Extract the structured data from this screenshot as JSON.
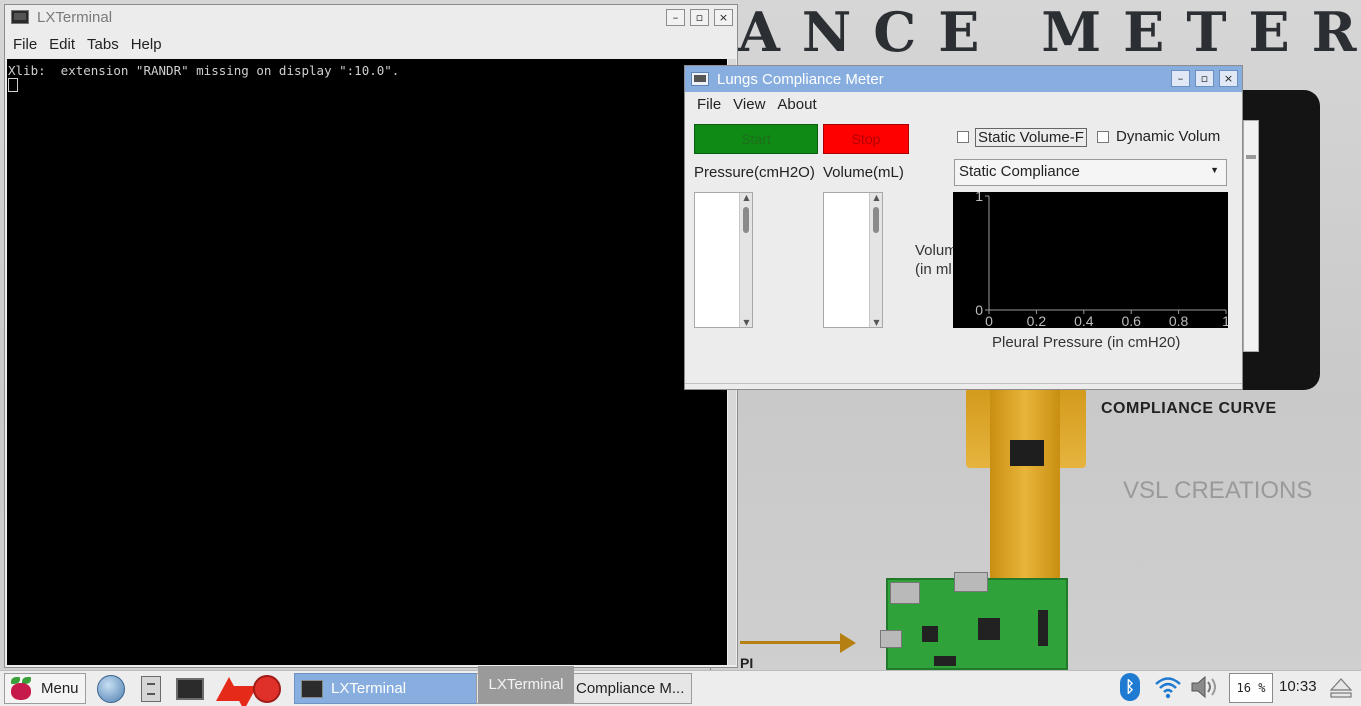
{
  "wallpaper": {
    "title_part1": "ANCE",
    "title_part2": "METER",
    "compliance_curve": "COMPLIANCE CURVE",
    "credit": "VSL CREATIONS",
    "pi_label": "PI"
  },
  "terminal": {
    "title": "LXTerminal",
    "menu": [
      "File",
      "Edit",
      "Tabs",
      "Help"
    ],
    "output": "Xlib:  extension \"RANDR\" missing on display \":10.0\".",
    "controls": {
      "minimize": "–",
      "maximize": "▫",
      "close": "×"
    }
  },
  "lungs_window": {
    "title": "Lungs Compliance Meter",
    "menu": [
      "File",
      "View",
      "About"
    ],
    "start_label": "Start",
    "stop_label": "Stop",
    "static_checkbox_label": "Static Volume-F",
    "dynamic_checkbox_label": "Dynamic Volum",
    "pressure_label": "Pressure(cmH2O)",
    "volume_label": "Volume(mL)",
    "mode_select": "Static Compliance",
    "y_axis_label_line1": "Volum",
    "y_axis_label_line2": "(in ml",
    "x_axis_label": "Pleural Pressure (in cmH20)",
    "colors": {
      "start": "#0f8a14",
      "stop": "#ff0000",
      "plot_bg": "#000000",
      "titlebar": "#87aede"
    }
  },
  "chart_data": {
    "type": "line",
    "title": "",
    "xlabel": "Pleural Pressure (in cmH20)",
    "ylabel": "Volum (in ml",
    "xlim": [
      0,
      1
    ],
    "ylim": [
      0,
      1
    ],
    "x_ticks": [
      "0",
      "0.2",
      "0.4",
      "0.6",
      "0.8",
      "1"
    ],
    "y_ticks": [
      "0",
      "1"
    ],
    "series": []
  },
  "taskbar": {
    "menu_label": "Menu",
    "task_terminal": "LXTerminal",
    "task_lungs": "Compliance M...",
    "tooltip": "LXTerminal",
    "cpu": "16 %",
    "clock": "10:33",
    "launchers": [
      "web-browser-icon",
      "file-manager-icon",
      "terminal-icon",
      "mathematica-icon",
      "wolfram-icon"
    ]
  }
}
